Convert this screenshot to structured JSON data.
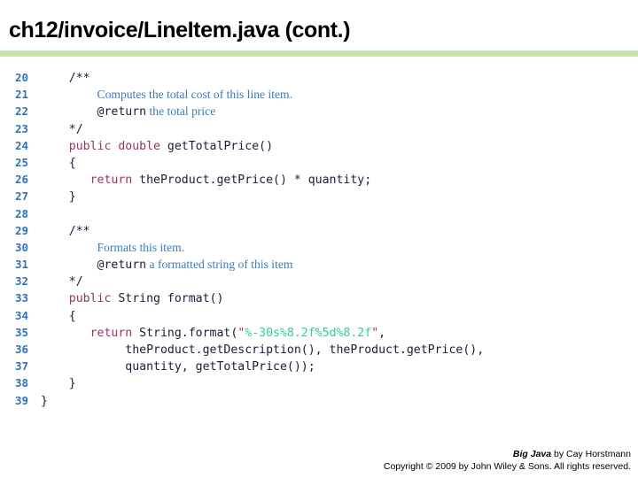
{
  "header": {
    "title": "ch12/invoice/LineItem.java (cont.)",
    "rule_color": "#c7e3ab"
  },
  "colors": {
    "line_number": "#2f72bf",
    "keyword": "#993366",
    "plain_code": "#1b1b3a",
    "comment_body": "#3a7cb8",
    "string_quote": "#c0392b",
    "string_body": "#33cc99",
    "header_rule": "#c7e3ab"
  },
  "code": {
    "language": "java",
    "first_line_number": 20,
    "lines": [
      {
        "num": "20",
        "tokens": [
          {
            "t": "cmt-delim",
            "s": "    /**"
          }
        ]
      },
      {
        "num": "21",
        "tokens": [
          {
            "t": "plain",
            "s": "        "
          },
          {
            "t": "cmt-body",
            "s": "Computes the total cost of this line item."
          }
        ]
      },
      {
        "num": "22",
        "tokens": [
          {
            "t": "plain",
            "s": "        "
          },
          {
            "t": "cmt-tag",
            "s": "@return"
          },
          {
            "t": "cmt-body",
            "s": " the total price"
          }
        ]
      },
      {
        "num": "23",
        "tokens": [
          {
            "t": "cmt-delim",
            "s": "    */"
          }
        ]
      },
      {
        "num": "24",
        "tokens": [
          {
            "t": "plain",
            "s": "    "
          },
          {
            "t": "kw",
            "s": "public double"
          },
          {
            "t": "plain",
            "s": " getTotalPrice()"
          }
        ]
      },
      {
        "num": "25",
        "tokens": [
          {
            "t": "plain",
            "s": "    {"
          }
        ]
      },
      {
        "num": "26",
        "tokens": [
          {
            "t": "plain",
            "s": "       "
          },
          {
            "t": "kw",
            "s": "return"
          },
          {
            "t": "plain",
            "s": " theProduct.getPrice() * quantity;"
          }
        ]
      },
      {
        "num": "27",
        "tokens": [
          {
            "t": "plain",
            "s": "    }"
          }
        ]
      },
      {
        "num": "28",
        "tokens": [
          {
            "t": "plain",
            "s": ""
          }
        ]
      },
      {
        "num": "29",
        "tokens": [
          {
            "t": "cmt-delim",
            "s": "    /**"
          }
        ]
      },
      {
        "num": "30",
        "tokens": [
          {
            "t": "plain",
            "s": "        "
          },
          {
            "t": "cmt-body",
            "s": "Formats this item."
          }
        ]
      },
      {
        "num": "31",
        "tokens": [
          {
            "t": "plain",
            "s": "        "
          },
          {
            "t": "cmt-tag",
            "s": "@return"
          },
          {
            "t": "cmt-body",
            "s": " a formatted string of this item"
          }
        ]
      },
      {
        "num": "32",
        "tokens": [
          {
            "t": "cmt-delim",
            "s": "    */"
          }
        ]
      },
      {
        "num": "33",
        "tokens": [
          {
            "t": "plain",
            "s": "    "
          },
          {
            "t": "kw",
            "s": "public"
          },
          {
            "t": "plain",
            "s": " String format()"
          }
        ]
      },
      {
        "num": "34",
        "tokens": [
          {
            "t": "plain",
            "s": "    {"
          }
        ]
      },
      {
        "num": "35",
        "tokens": [
          {
            "t": "plain",
            "s": "       "
          },
          {
            "t": "kw",
            "s": "return"
          },
          {
            "t": "plain",
            "s": " String.format("
          },
          {
            "t": "str-quote",
            "s": "\""
          },
          {
            "t": "str-body",
            "s": "%-30s%8.2f%5d%8.2f"
          },
          {
            "t": "str-quote",
            "s": "\""
          },
          {
            "t": "plain",
            "s": ","
          }
        ]
      },
      {
        "num": "36",
        "tokens": [
          {
            "t": "plain",
            "s": "            theProduct.getDescription(), theProduct.getPrice(),"
          }
        ]
      },
      {
        "num": "37",
        "tokens": [
          {
            "t": "plain",
            "s": "            quantity, getTotalPrice());"
          }
        ]
      },
      {
        "num": "38",
        "tokens": [
          {
            "t": "plain",
            "s": "    }"
          }
        ]
      },
      {
        "num": "39",
        "tokens": [
          {
            "t": "plain",
            "s": "}"
          }
        ]
      }
    ]
  },
  "footer": {
    "book_title": "Big Java",
    "byline": " by Cay Horstmann",
    "copyright": "Copyright © 2009 by John Wiley & Sons.  All rights reserved."
  }
}
